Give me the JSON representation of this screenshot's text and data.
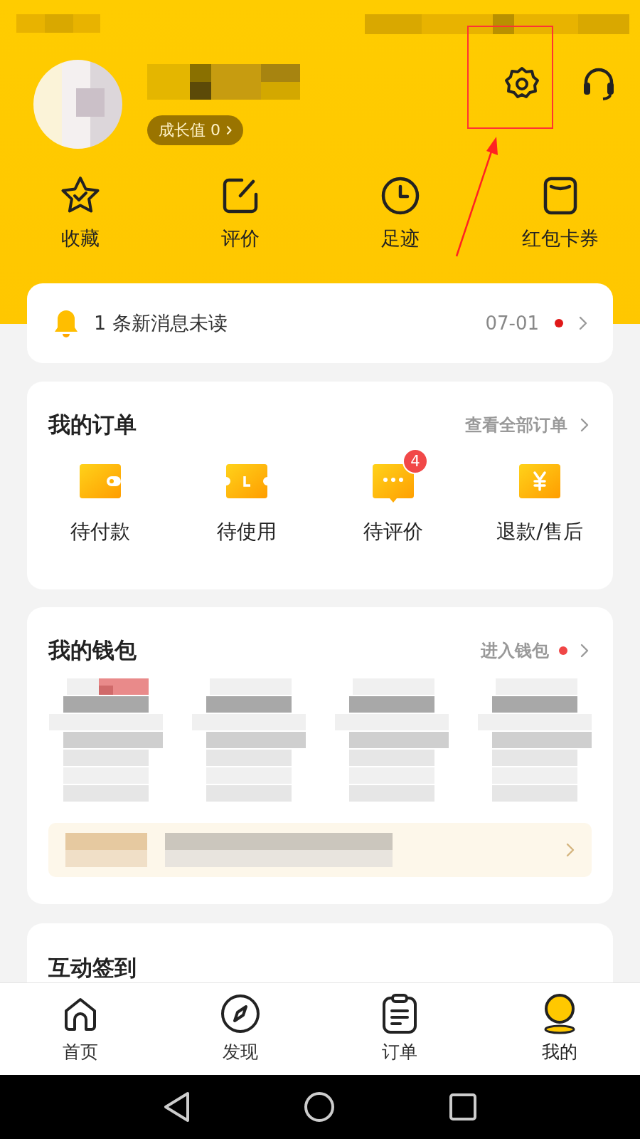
{
  "profile": {
    "growth": "成长值 0"
  },
  "quick_links": [
    {
      "label": "收藏",
      "kind": "star"
    },
    {
      "label": "评价",
      "kind": "edit"
    },
    {
      "label": "足迹",
      "kind": "clock"
    },
    {
      "label": "红包卡券",
      "kind": "coupon"
    }
  ],
  "message": {
    "text": "1 条新消息未读",
    "date": "07-01",
    "unread": true
  },
  "orders": {
    "title": "我的订单",
    "link": "查看全部订单",
    "items": [
      {
        "label": "待付款",
        "kind": "wallet"
      },
      {
        "label": "待使用",
        "kind": "ticket"
      },
      {
        "label": "待评价",
        "kind": "chat",
        "badge": "4"
      },
      {
        "label": "退款/售后",
        "kind": "yen"
      }
    ]
  },
  "wallet": {
    "title": "我的钱包",
    "link": "进入钱包",
    "unread": true
  },
  "checkin": {
    "title": "互动签到"
  },
  "tab_bar": [
    {
      "label": "首页",
      "kind": "home",
      "selected": false
    },
    {
      "label": "发现",
      "kind": "compass",
      "selected": false
    },
    {
      "label": "订单",
      "kind": "clipboard",
      "selected": false
    },
    {
      "label": "我的",
      "kind": "user",
      "selected": true
    }
  ]
}
